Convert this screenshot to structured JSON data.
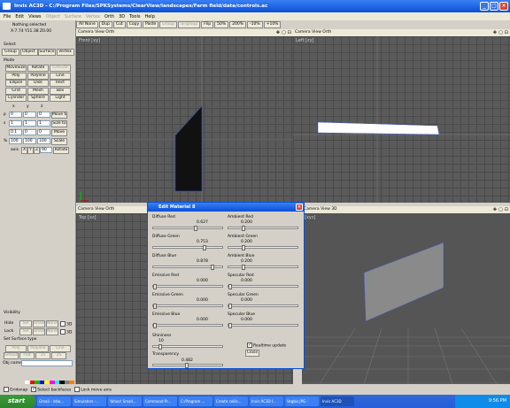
{
  "app": {
    "title": "Invis AC3D - C:/Program Files/SPKSystems/ClearView/landscapes/Farm field/data/controls.ac"
  },
  "menu": [
    "File",
    "Edit",
    "Views",
    "Object",
    "Surface",
    "Vertex",
    "Orth",
    "3D",
    "Tools",
    "Help"
  ],
  "menu_disabled": [
    false,
    false,
    false,
    true,
    true,
    true,
    false,
    false,
    false,
    false
  ],
  "toolbar": [
    "All None",
    "Dup",
    "Cut",
    "Copy",
    "Paste",
    "Group",
    "Ungroup",
    "Flip",
    "50%",
    "200%",
    "-10%",
    "+10%"
  ],
  "toolbar_disabled": [
    false,
    false,
    false,
    false,
    false,
    true,
    true,
    false,
    false,
    false,
    false,
    false
  ],
  "left": {
    "status": "Nothing selected",
    "coords": "X-7.74 Y11.38 Z0.00",
    "select_label": "Select",
    "select_modes": [
      "Group",
      "Object",
      "Surface",
      "Vertex"
    ],
    "mode_label": "Mode",
    "mode_buttons": [
      "MoveSize",
      "Rotate",
      "Extrude",
      "Poly",
      "Polyline",
      "Line",
      "Ellipse",
      "Disk",
      "Rect",
      "Grid",
      "Mesh",
      "Box",
      "Cylinder",
      "Sphere",
      "Light"
    ],
    "mode_disabled": [
      false,
      false,
      true,
      false,
      false,
      false,
      false,
      false,
      false,
      false,
      false,
      false,
      false,
      false,
      false
    ],
    "axes": [
      "x",
      "y",
      "z"
    ],
    "move_vals": [
      "0",
      "0",
      "0"
    ],
    "move_btn": "Move to",
    "move_prefix": "p",
    "size_vals": [
      "1",
      "1",
      "1"
    ],
    "size_btn": "Size to",
    "size_prefix": "s",
    "moveby_vals": [
      "0.1",
      "0",
      "0"
    ],
    "moveby_btn": "Move",
    "scale_vals": [
      "100",
      "100",
      "100"
    ],
    "scale_btn": "Scale",
    "scale_prefix": "%",
    "axis_label": "axis",
    "axis_opts": [
      "X",
      "Y",
      "Z"
    ],
    "rotate_val": "90",
    "rotate_btn": "Rotate",
    "visibility_label": "Visibility",
    "hide_label": "Hide",
    "lock_label": "Lock",
    "vis_btns": [
      "Sel",
      "Unsel",
      "None"
    ],
    "vis_3d": "3D",
    "surface_label": "Set Surface type",
    "surface_btns": [
      "Poly",
      "Polyline",
      "Line",
      "Smooth",
      "Flat",
      "1S",
      "2S"
    ],
    "objname_label": "Obj name",
    "palette": [
      "#ffffff",
      "#ff0000",
      "#00c000",
      "#0000ff",
      "#ffff00",
      "#ff00ff",
      "#00ffff",
      "#000000",
      "#808080",
      "#ff8000"
    ]
  },
  "views": [
    {
      "head": "Camera View Orth",
      "label": "Front [xy]"
    },
    {
      "head": "Camera View Orth",
      "label": "Left [zy]"
    },
    {
      "head": "Camera View Orth",
      "label": "Top [xz]"
    },
    {
      "head": "Camera View 3D",
      "label": "[xyz]"
    }
  ],
  "dialog": {
    "title": "Edit Material 8",
    "fields": [
      {
        "label": "Diffuse Red",
        "value": "0.627",
        "level": 0.627
      },
      {
        "label": "Ambient Red",
        "value": "0.200",
        "level": 0.2
      },
      {
        "label": "Diffuse Green",
        "value": "0.753",
        "level": 0.753
      },
      {
        "label": "Ambient Green",
        "value": "0.200",
        "level": 0.2
      },
      {
        "label": "Diffuse Blue",
        "value": "0.878",
        "level": 0.878
      },
      {
        "label": "Ambient Blue",
        "value": "0.200",
        "level": 0.2
      },
      {
        "label": "Emissive Red",
        "value": "0.000",
        "level": 0.0
      },
      {
        "label": "Specular Red",
        "value": "0.000",
        "level": 0.0
      },
      {
        "label": "Emissive Green",
        "value": "0.000",
        "level": 0.0
      },
      {
        "label": "Specular Green",
        "value": "0.000",
        "level": 0.0
      },
      {
        "label": "Emissive Blue",
        "value": "0.000",
        "level": 0.0
      },
      {
        "label": "Specular Blue",
        "value": "0.000",
        "level": 0.0
      }
    ],
    "shininess_label": "Shininess",
    "shininess_value": "10",
    "shininess_level": 0.08,
    "transparency_label": "Transparency",
    "transparency_value": "0.482",
    "transparency_level": 0.482,
    "realtime_label": "Realtime update",
    "close_label": "Close"
  },
  "statusbar": {
    "gridsnap": "Gridsnap",
    "select_back": "Select backfaces",
    "lock_axis": "Lock move axis"
  },
  "taskbar": {
    "start": "start",
    "tasks": [
      "Gmail - Inbo...",
      "Simulators -...",
      "Yahoo! Small...",
      "Command Pr...",
      "C:/Program ...",
      "Create collis...",
      "Invis AC3D I...",
      "Vegbis.JPG -",
      "Invis AC3D"
    ],
    "active": 8,
    "time": "9:56 PM"
  }
}
